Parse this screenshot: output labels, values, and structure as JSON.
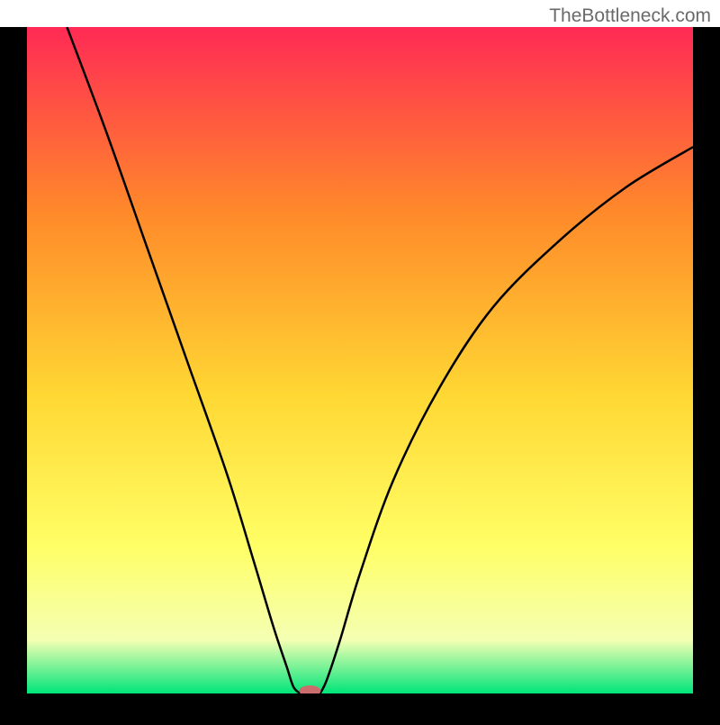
{
  "watermark": "TheBottleneck.com",
  "chart_data": {
    "type": "line",
    "title": "",
    "xlabel": "",
    "ylabel": "",
    "xlim": [
      0,
      100
    ],
    "ylim": [
      0,
      100
    ],
    "background_gradient": {
      "top": "#ff2a55",
      "upper_mid": "#ff8a2a",
      "mid": "#ffd733",
      "lower_mid": "#ffff66",
      "lower": "#f4ffb3",
      "bottom": "#00e57a"
    },
    "curve_left": [
      {
        "x": 6,
        "y": 100
      },
      {
        "x": 12,
        "y": 84
      },
      {
        "x": 18,
        "y": 67
      },
      {
        "x": 24,
        "y": 50
      },
      {
        "x": 30,
        "y": 33
      },
      {
        "x": 34,
        "y": 20
      },
      {
        "x": 37,
        "y": 10
      },
      {
        "x": 39,
        "y": 4
      },
      {
        "x": 40,
        "y": 1
      },
      {
        "x": 41,
        "y": 0
      }
    ],
    "curve_right": [
      {
        "x": 44,
        "y": 0
      },
      {
        "x": 45,
        "y": 2
      },
      {
        "x": 47,
        "y": 8
      },
      {
        "x": 50,
        "y": 18
      },
      {
        "x": 55,
        "y": 32
      },
      {
        "x": 62,
        "y": 46
      },
      {
        "x": 70,
        "y": 58
      },
      {
        "x": 80,
        "y": 68
      },
      {
        "x": 90,
        "y": 76
      },
      {
        "x": 100,
        "y": 82
      }
    ],
    "marker": {
      "x": 42.5,
      "y": 0,
      "color": "#cc6d6d"
    },
    "frame": {
      "border": "#000000",
      "border_width_left_right_bottom": 30,
      "border_width_top": 0
    }
  }
}
